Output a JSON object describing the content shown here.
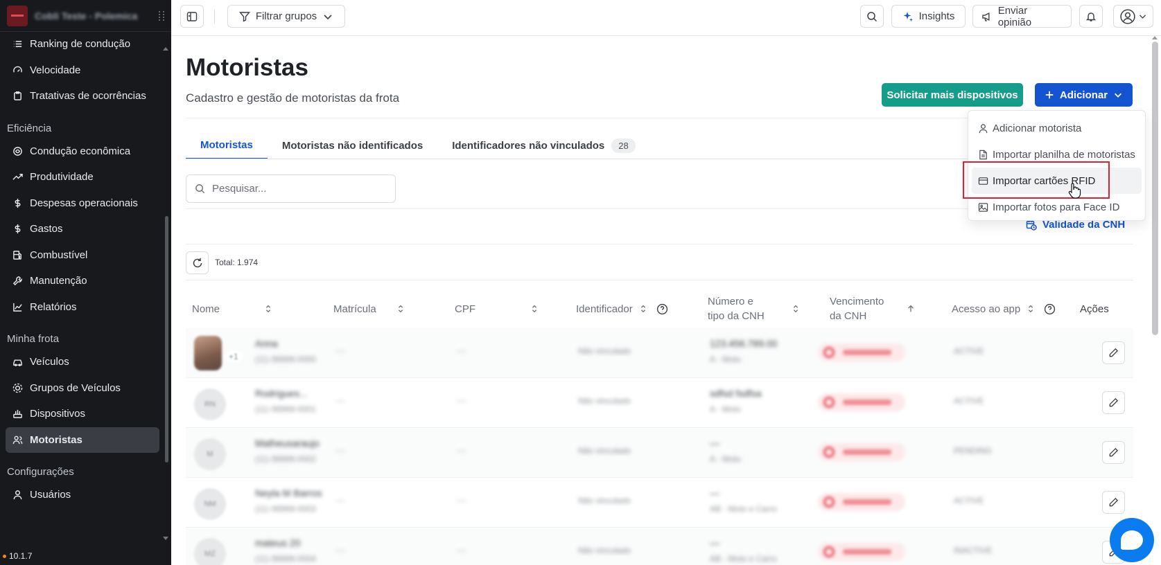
{
  "sidebar": {
    "company": "Cobli Teste - Polemica",
    "items_top": [
      {
        "label": "Ranking de condução",
        "icon": "list-icon"
      },
      {
        "label": "Velocidade",
        "icon": "gauge-icon"
      },
      {
        "label": "Tratativas de ocorrências",
        "icon": "clipboard-icon"
      }
    ],
    "section_eficiencia": "Eficiência",
    "items_eficiencia": [
      {
        "label": "Condução econômica",
        "icon": "leaf-icon"
      },
      {
        "label": "Produtividade",
        "icon": "trending-up-icon"
      },
      {
        "label": "Despesas operacionais",
        "icon": "dollar-icon"
      },
      {
        "label": "Gastos",
        "icon": "dollar-icon"
      },
      {
        "label": "Combustível",
        "icon": "fuel-icon"
      },
      {
        "label": "Manutenção",
        "icon": "wrench-icon"
      },
      {
        "label": "Relatórios",
        "icon": "chart-line-icon"
      }
    ],
    "section_frota": "Minha frota",
    "items_frota": [
      {
        "label": "Veículos",
        "icon": "car-icon"
      },
      {
        "label": "Grupos de Veículos",
        "icon": "group-icon"
      },
      {
        "label": "Dispositivos",
        "icon": "device-icon"
      },
      {
        "label": "Motoristas",
        "icon": "users-icon",
        "active": true
      }
    ],
    "section_config": "Configurações",
    "items_config": [
      {
        "label": "Usuários",
        "icon": "user-icon"
      }
    ],
    "version": "10.1.7"
  },
  "topbar": {
    "filter_label": "Filtrar grupos",
    "insights_label": "Insights",
    "feedback_label": "Enviar opinião"
  },
  "page": {
    "title": "Motoristas",
    "subtitle": "Cadastro e gestão de motoristas da frota",
    "btn_request": "Solicitar mais dispositivos",
    "btn_add": "Adicionar"
  },
  "tabs": [
    {
      "label": "Motoristas",
      "active": true
    },
    {
      "label": "Motoristas não identificados"
    },
    {
      "label": "Identificadores não vinculados",
      "count": "28"
    }
  ],
  "search": {
    "placeholder": "Pesquisar..."
  },
  "cnh_link": "Validade da CNH",
  "total": "Total: 1.974",
  "columns": {
    "nome": "Nome",
    "matricula": "Matrícula",
    "cpf": "CPF",
    "identificador": "Identificador",
    "cnh_l1": "Número e",
    "cnh_l2": "tipo da CNH",
    "venc_l1": "Vencimento",
    "venc_l2": "da CNH",
    "acesso": "Acesso ao app",
    "acoes": "Ações"
  },
  "rows": [
    {
      "avatar": "",
      "name": "Anna",
      "phone": "(11) 99999-0000",
      "matricula": "—",
      "cpf": "—",
      "ident": "Não vinculado",
      "cnh": "123.456.789.00",
      "cnh_type": "A - Moto",
      "access": "ACTIVE",
      "photo_extra": "+1"
    },
    {
      "avatar": "RN",
      "name": "Rodrigues...",
      "phone": "(11) 99999-0001",
      "matricula": "—",
      "cpf": "—",
      "ident": "Não vinculado",
      "cnh": "sdfsd fsdfsa",
      "cnh_type": "A - Moto",
      "access": "ACTIVE"
    },
    {
      "avatar": "M",
      "name": "Matheusaraujo",
      "phone": "(11) 99999-0002",
      "matricula": "—",
      "cpf": "—",
      "ident": "Não vinculado",
      "cnh": "—",
      "cnh_type": "A - Moto",
      "access": "PENDING"
    },
    {
      "avatar": "NM",
      "name": "Neyla M Barros",
      "phone": "(11) 99999-0003",
      "matricula": "—",
      "cpf": "—",
      "ident": "Não vinculado",
      "cnh": "—",
      "cnh_type": "AB - Moto e Carro",
      "access": "ACTIVE"
    },
    {
      "avatar": "MZ",
      "name": "mateus 20",
      "phone": "(11) 99999-0004",
      "matricula": "—",
      "cpf": "—",
      "ident": "Não vinculado",
      "cnh": "—",
      "cnh_type": "AB - Moto e Carro",
      "access": "INACTIVE"
    }
  ],
  "dropdown": [
    {
      "label": "Adicionar motorista",
      "icon": "user-icon"
    },
    {
      "label": "Importar planilha de motoristas",
      "icon": "file-icon"
    },
    {
      "label": "Importar cartões RFID",
      "icon": "card-icon",
      "hover": true
    },
    {
      "label": "Importar fotos para Face ID",
      "icon": "image-icon"
    }
  ],
  "colors": {
    "primary": "#1554d1",
    "teal": "#169c8a",
    "sidebar_bg": "#17191d",
    "highlight": "#e0202f"
  }
}
